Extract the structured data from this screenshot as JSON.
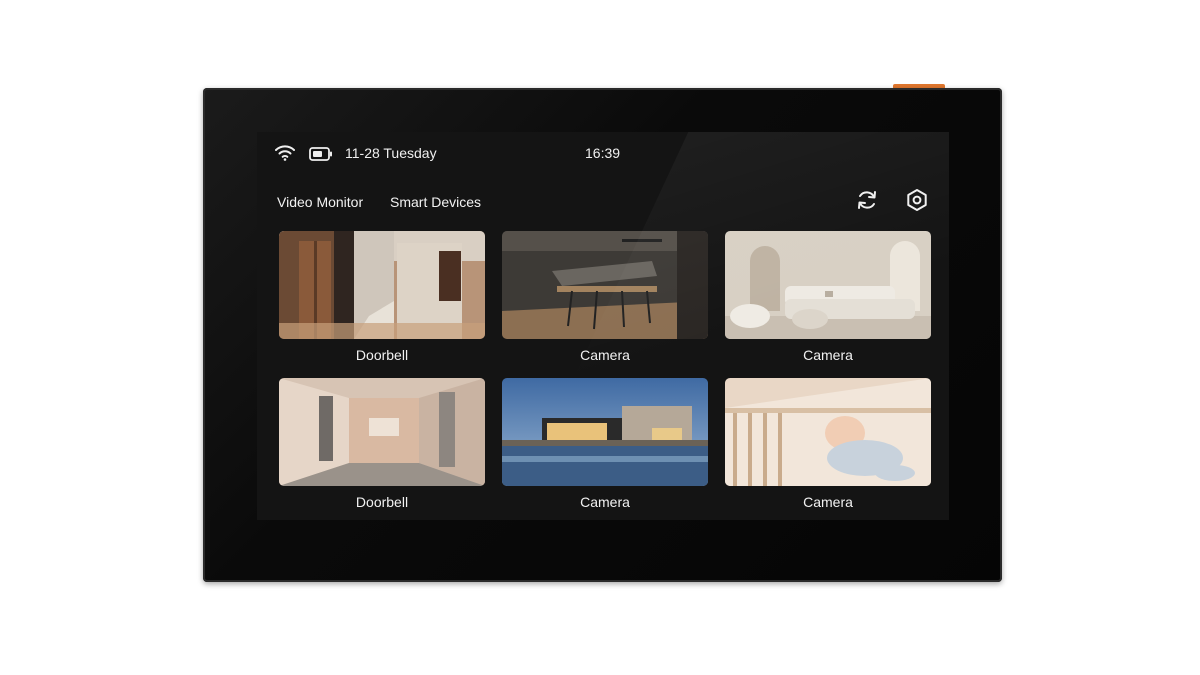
{
  "status_bar": {
    "wifi_icon": "wifi-icon",
    "battery_icon": "battery-icon",
    "date": "11-28 Tuesday",
    "time": "16:39"
  },
  "tabs": [
    {
      "label": "Video Monitor"
    },
    {
      "label": "Smart Devices"
    }
  ],
  "toolbar": {
    "refresh_icon": "refresh-icon",
    "settings_icon": "settings-icon"
  },
  "devices": [
    {
      "label": "Doorbell",
      "scene": "hallway-elevator"
    },
    {
      "label": "Camera",
      "scene": "kitchen-dining"
    },
    {
      "label": "Camera",
      "scene": "living-room"
    },
    {
      "label": "Doorbell",
      "scene": "corridor"
    },
    {
      "label": "Camera",
      "scene": "house-pool"
    },
    {
      "label": "Camera",
      "scene": "baby-crib"
    }
  ],
  "colors": {
    "accent_button": "#e0772e",
    "screen_bg": "#141414",
    "text": "#f2f2f2"
  }
}
